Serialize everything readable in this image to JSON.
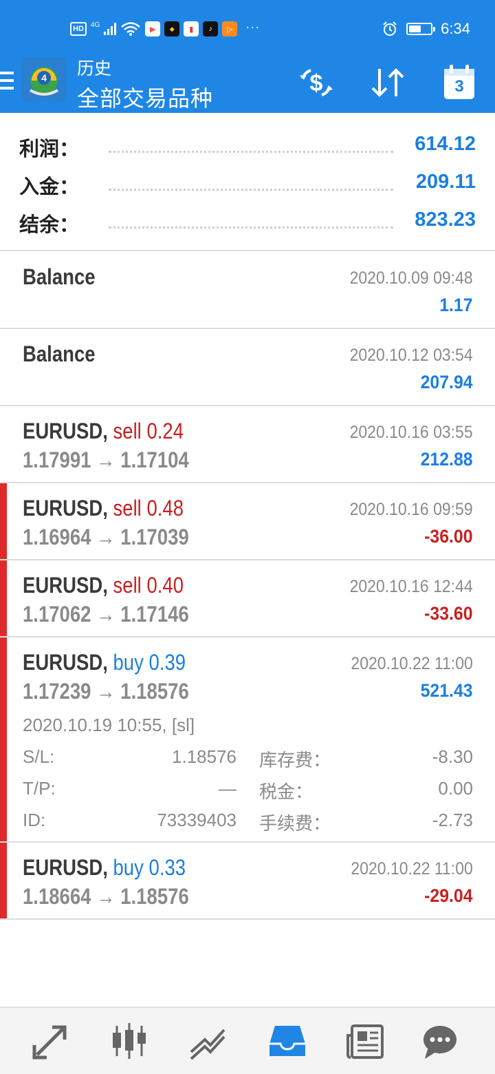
{
  "status_bar": {
    "hd": "HD",
    "net": "4G",
    "time": "6:34",
    "battery_level": 0.55
  },
  "app_bar": {
    "title": "历史",
    "subtitle": "全部交易品种",
    "calendar_day": "3"
  },
  "summary": [
    {
      "label": "利润：",
      "value": "614.12"
    },
    {
      "label": "入金：",
      "value": "209.11"
    },
    {
      "label": "结余：",
      "value": "823.23"
    }
  ],
  "deals": [
    {
      "symbol": "Balance",
      "time": "2020.10.09 09:48",
      "profit": "1.17"
    },
    {
      "symbol": "Balance",
      "time": "2020.10.12 03:54",
      "profit": "207.94"
    }
  ],
  "orders": [
    {
      "symbol": "EURUSD,",
      "side": "sell 0.24",
      "prices": "1.17991 → 1.17104",
      "time": "2020.10.16 03:55",
      "profit": "212.88"
    },
    {
      "symbol": "EURUSD,",
      "side": "sell 0.48",
      "prices": "1.16964 → 1.17039",
      "time": "2020.10.16 09:59",
      "profit": "-36.00"
    },
    {
      "symbol": "EURUSD,",
      "side": "sell 0.40",
      "prices": "1.17062 → 1.17146",
      "time": "2020.10.16 12:44",
      "profit": "-33.60"
    },
    {
      "symbol": "EURUSD,",
      "side": "buy 0.39",
      "prices": "1.17239 → 1.18576",
      "time": "2020.10.22 11:00",
      "profit": "521.43",
      "details": {
        "open": "2020.10.19 10:55, [sl]",
        "sl_label": "S/L:",
        "sl": "1.18576",
        "tp_label": "T/P:",
        "tp": "—",
        "id_label": "ID:",
        "id": "73339403",
        "swap_label": "库存费：",
        "swap": "-8.30",
        "tax_label": "税金：",
        "tax": "0.00",
        "fee_label": "手续费：",
        "fee": "-2.73"
      }
    },
    {
      "symbol": "EURUSD,",
      "side": "buy 0.33",
      "prices": "1.18664 → 1.18576",
      "time": "2020.10.22 11:00",
      "profit": "-29.04"
    }
  ],
  "colors": {
    "primary": "#1f86e5",
    "positive": "#1b7fe0",
    "negative": "#c82020",
    "loss_flag": "#e02a2a"
  },
  "bottom_nav": [
    "trade-icon",
    "quotes-icon",
    "chart-icon",
    "history-icon",
    "news-icon",
    "chat-icon"
  ],
  "bottom_nav_active": "history-icon"
}
